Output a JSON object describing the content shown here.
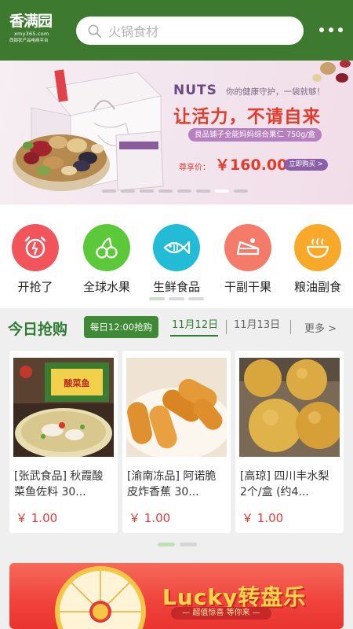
{
  "app": {
    "logo_main": "香满园",
    "logo_url": "xmy365.com",
    "logo_sub": "西部农产品电商平台"
  },
  "header": {
    "search_placeholder": "火锅食材",
    "search_icon": "search-icon",
    "more_icon": "more-dots-icon",
    "bg_color": "#3d7a2f"
  },
  "banner": {
    "brand": "NUTS",
    "tagline": "你的健康守护，一袋就够！",
    "slogan": "让活力，不请自来",
    "product": "良品铺子全能妈妈综合果仁 750g/盒",
    "price_label": "尊享价：",
    "price": "￥160.00",
    "buy": "立即购买 >",
    "pages": 8,
    "active_page": 7
  },
  "categories": [
    {
      "label": "开抢了",
      "icon": "alarm-clock-icon",
      "color": "#f2545b"
    },
    {
      "label": "全球水果",
      "icon": "cherry-icon",
      "color": "#5cc93a"
    },
    {
      "label": "生鲜食品",
      "icon": "fish-icon",
      "color": "#23bcd6"
    },
    {
      "label": "干副干果",
      "icon": "cake-icon",
      "color": "#f47b6a"
    },
    {
      "label": "粮油副食",
      "icon": "bowl-icon",
      "color": "#f9a92a"
    }
  ],
  "today": {
    "title": "今日抢购",
    "time_badge": "每日12:00抢购",
    "tabs": [
      "11月12日",
      "11月13日"
    ],
    "more": "更多 >",
    "products": [
      {
        "name": "[张武食品] 秋霞酸菜鱼佐料 30...",
        "price": "￥ 1.00"
      },
      {
        "name": "[渝南冻品] 阿诺脆皮炸香蕉 30...",
        "price": "￥ 1.00"
      },
      {
        "name": "[高琼] 四川丰水梨 2个/盒 (约4...",
        "price": "￥ 1.00"
      }
    ]
  },
  "lucky": {
    "title": "Lucky转盘乐",
    "subtitle": "— 超值惊喜 等你来 —"
  }
}
